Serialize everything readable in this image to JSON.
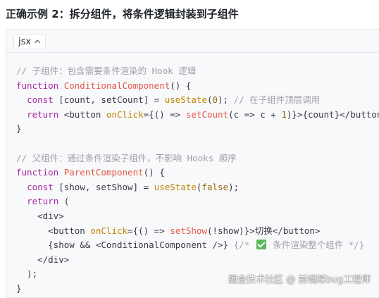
{
  "heading": "正确示例 2：拆分组件，将条件逻辑封装到子组件",
  "code_block": {
    "language": "jsx",
    "lines": [
      [
        {
          "t": "// 子组件：包含需要条件渲染的 Hook 逻辑",
          "c": "t-comment"
        }
      ],
      [
        {
          "t": "function ",
          "c": "t-keyword"
        },
        {
          "t": "ConditionalComponent",
          "c": "t-func"
        },
        {
          "t": "() {",
          "c": "t-plain"
        }
      ],
      [
        {
          "t": "  ",
          "c": "t-plain"
        },
        {
          "t": "const ",
          "c": "t-keyword"
        },
        {
          "t": "[count, setCount] = ",
          "c": "t-plain"
        },
        {
          "t": "useState",
          "c": "t-call"
        },
        {
          "t": "(",
          "c": "t-plain"
        },
        {
          "t": "0",
          "c": "t-number"
        },
        {
          "t": "); ",
          "c": "t-plain"
        },
        {
          "t": "// 在子组件顶层调用",
          "c": "t-comment"
        }
      ],
      [
        {
          "t": "  ",
          "c": "t-plain"
        },
        {
          "t": "return ",
          "c": "t-keyword"
        },
        {
          "t": "<button ",
          "c": "t-plain"
        },
        {
          "t": "onClick",
          "c": "t-call"
        },
        {
          "t": "={() => ",
          "c": "t-plain"
        },
        {
          "t": "setCount",
          "c": "t-func"
        },
        {
          "t": "(c => c + ",
          "c": "t-plain"
        },
        {
          "t": "1",
          "c": "t-number"
        },
        {
          "t": ")}>{count}</button>;",
          "c": "t-plain"
        }
      ],
      [
        {
          "t": "}",
          "c": "t-plain"
        }
      ],
      [],
      [
        {
          "t": "// 父组件：通过条件渲染子组件，不影响 Hooks 顺序",
          "c": "t-comment"
        }
      ],
      [
        {
          "t": "function ",
          "c": "t-keyword"
        },
        {
          "t": "ParentComponent",
          "c": "t-func"
        },
        {
          "t": "() {",
          "c": "t-plain"
        }
      ],
      [
        {
          "t": "  ",
          "c": "t-plain"
        },
        {
          "t": "const ",
          "c": "t-keyword"
        },
        {
          "t": "[show, setShow] = ",
          "c": "t-plain"
        },
        {
          "t": "useState",
          "c": "t-call"
        },
        {
          "t": "(",
          "c": "t-plain"
        },
        {
          "t": "false",
          "c": "t-number"
        },
        {
          "t": ");",
          "c": "t-plain"
        }
      ],
      [
        {
          "t": "  ",
          "c": "t-plain"
        },
        {
          "t": "return ",
          "c": "t-keyword"
        },
        {
          "t": "(",
          "c": "t-plain"
        }
      ],
      [
        {
          "t": "    <div>",
          "c": "t-plain"
        }
      ],
      [
        {
          "t": "      <button ",
          "c": "t-plain"
        },
        {
          "t": "onClick",
          "c": "t-call"
        },
        {
          "t": "={() => ",
          "c": "t-plain"
        },
        {
          "t": "setShow",
          "c": "t-func"
        },
        {
          "t": "(!show)}>",
          "c": "t-plain"
        },
        {
          "t": "切换",
          "c": "t-plain t-cjk"
        },
        {
          "t": "</button>",
          "c": "t-plain"
        }
      ],
      [
        {
          "t": "      {show && <ConditionalComponent />} ",
          "c": "t-plain"
        },
        {
          "t": "{/* ",
          "c": "t-comment"
        },
        {
          "t": "✅",
          "c": "emoji"
        },
        {
          "t": " 条件渲染整个组件 */}",
          "c": "t-comment"
        }
      ],
      [
        {
          "t": "    </div>",
          "c": "t-plain"
        }
      ],
      [
        {
          "t": "  );",
          "c": "t-plain"
        }
      ],
      [
        {
          "t": "}",
          "c": "t-plain"
        }
      ]
    ]
  },
  "watermark": "掘金技术社区 @ 前端踩bug工程师",
  "colors": {
    "comment": "#a0a1a7",
    "keyword": "#a626a4",
    "function": "#e45649",
    "call": "#c18401",
    "number": "#986801",
    "panel_bg": "#f8f9fa"
  },
  "icons": {
    "lang_toggle": "chevron-up-icon",
    "emoji": "check-mark-button-icon"
  }
}
